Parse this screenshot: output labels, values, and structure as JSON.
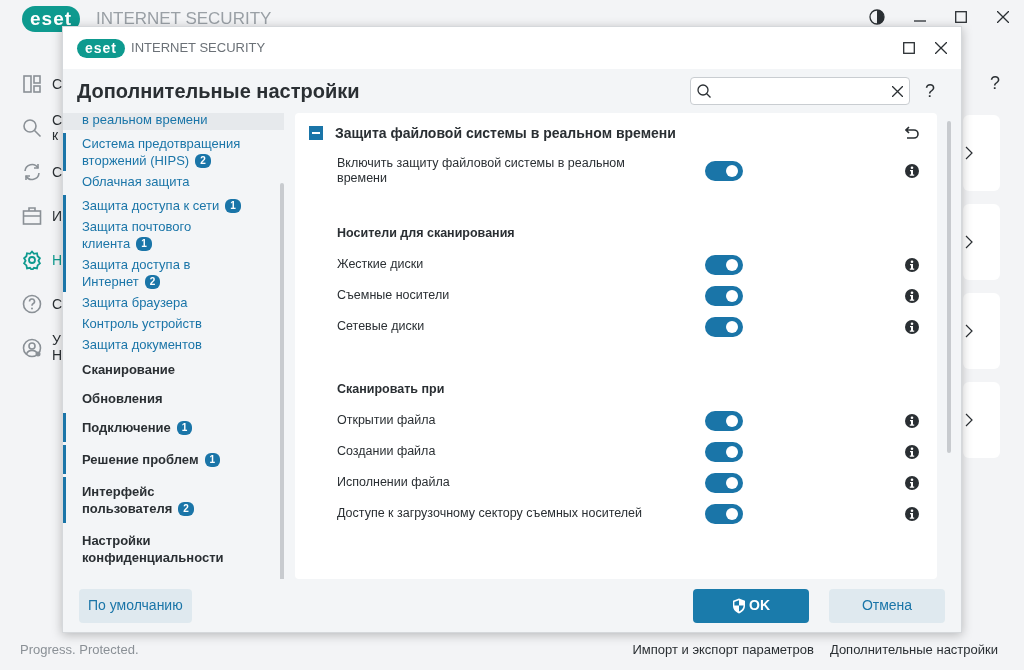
{
  "background_app": {
    "logo": "eset",
    "title": "INTERNET SECURITY",
    "help": "?",
    "sidebar": {
      "items": [
        {
          "lines": [
            "С"
          ],
          "selected": false
        },
        {
          "lines": [
            "С",
            "к"
          ],
          "selected": false
        },
        {
          "lines": [
            "С"
          ],
          "selected": false
        },
        {
          "lines": [
            "И"
          ],
          "selected": false
        },
        {
          "lines": [
            "Н"
          ],
          "selected": true
        },
        {
          "lines": [
            "С"
          ],
          "selected": false
        },
        {
          "lines": [
            "У",
            "Н"
          ],
          "selected": false
        }
      ]
    },
    "status": "Progress. Protected.",
    "links": [
      "Импорт и экспорт параметров",
      "Дополнительные настройки"
    ]
  },
  "dialog": {
    "logo": "eset",
    "title": "INTERNET SECURITY",
    "heading": "Дополнительные настройки",
    "help": "?",
    "nav": [
      {
        "text": "в реальном времени",
        "kind": "sub",
        "selected": true,
        "marked": false
      },
      {
        "text": "Система предотвращения вторжений (HIPS)",
        "kind": "sub",
        "badge": "2",
        "selected": false,
        "marked": true
      },
      {
        "text": "Облачная защита",
        "kind": "sub",
        "selected": false,
        "marked": false
      },
      {
        "text": "Защита доступа к сети",
        "kind": "sub",
        "badge": "1",
        "selected": false,
        "marked": true
      },
      {
        "text": "Защита почтового клиента",
        "kind": "sub",
        "badge": "1",
        "selected": false,
        "marked": true
      },
      {
        "text": "Защита доступа в Интернет",
        "kind": "sub",
        "badge": "2",
        "selected": false,
        "marked": true
      },
      {
        "text": "Защита браузера",
        "kind": "sub",
        "selected": false,
        "marked": false
      },
      {
        "text": "Контроль устройств",
        "kind": "sub",
        "selected": false,
        "marked": false
      },
      {
        "text": "Защита документов",
        "kind": "sub",
        "selected": false,
        "marked": false
      },
      {
        "text": "Сканирование",
        "kind": "section",
        "selected": false,
        "marked": false
      },
      {
        "text": "Обновления",
        "kind": "section",
        "selected": false,
        "marked": false
      },
      {
        "text": "Подключение",
        "kind": "section",
        "badge": "1",
        "selected": false,
        "marked": true
      },
      {
        "text": "Решение проблем",
        "kind": "section",
        "badge": "1",
        "selected": false,
        "marked": true
      },
      {
        "text": "Интерфейс пользователя",
        "kind": "section",
        "badge": "2",
        "selected": false,
        "marked": true
      },
      {
        "text": "Настройки конфиденциальности",
        "kind": "section",
        "selected": false,
        "marked": false
      }
    ],
    "section": {
      "title": "Защита файловой системы в реальном времени",
      "expanded": true,
      "rows": [
        {
          "kind": "toggle",
          "label": "Включить защиту файловой системы в реальном времени",
          "on": true
        },
        {
          "kind": "heading",
          "label": "Носители для сканирования"
        },
        {
          "kind": "toggle",
          "label": "Жесткие диски",
          "on": true
        },
        {
          "kind": "toggle",
          "label": "Съемные носители",
          "on": true
        },
        {
          "kind": "toggle",
          "label": "Сетевые диски",
          "on": true
        },
        {
          "kind": "heading",
          "label": "Сканировать при"
        },
        {
          "kind": "toggle",
          "label": "Открытии файла",
          "on": true
        },
        {
          "kind": "toggle",
          "label": "Создании файла",
          "on": true
        },
        {
          "kind": "toggle",
          "label": "Исполнении файла",
          "on": true
        },
        {
          "kind": "toggle",
          "label": "Доступе к загрузочному сектору съемных носителей",
          "on": true
        }
      ]
    },
    "buttons": {
      "default": "По умолчанию",
      "ok": "OK",
      "cancel": "Отмена"
    }
  }
}
